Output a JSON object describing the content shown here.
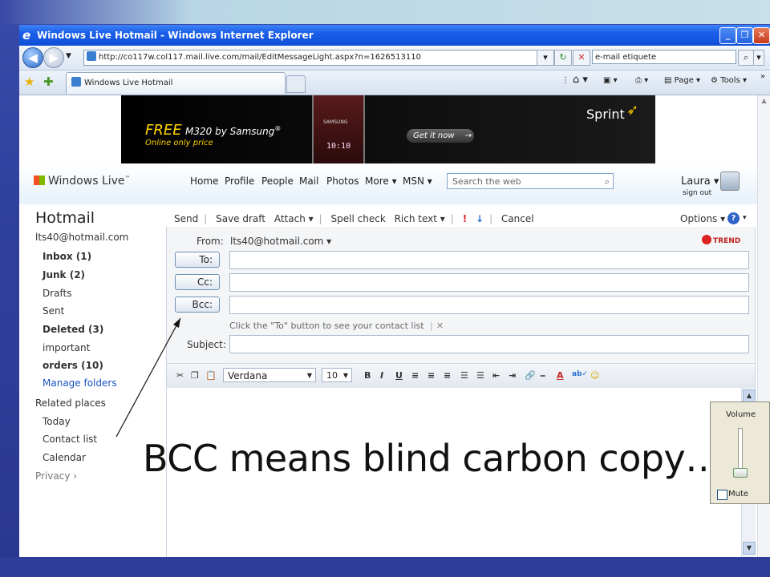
{
  "window": {
    "title": "Windows Live Hotmail - Windows Internet Explorer",
    "address": "http://co117w.col117.mail.live.com/mail/EditMessageLight.aspx?n=1626513110",
    "search_query": "e-mail etiquete",
    "tab_label": "Windows Live Hotmail",
    "cmd_page": "Page",
    "cmd_tools": "Tools"
  },
  "ad": {
    "free": "FREE",
    "model": "M320 by Samsung",
    "model_mark": "®",
    "online": "Online only price",
    "cta": "Get it now",
    "brand": "Sprint",
    "phone_brand": "SAMSUNG",
    "phone_time": "10:10"
  },
  "header": {
    "logo": "Windows Live",
    "logo_tm": "™",
    "nav": [
      "Home",
      "Profile",
      "People",
      "Mail",
      "Photos",
      "More ▾",
      "MSN ▾"
    ],
    "search_placeholder": "Search the web",
    "user_name": "Laura",
    "sign_out": "sign out"
  },
  "app": {
    "title": "Hotmail",
    "toolbar": [
      "Send",
      "Save draft",
      "Attach ▾",
      "Spell check",
      "Rich text ▾",
      "Cancel"
    ],
    "options": "Options ▾"
  },
  "sidebar": {
    "account": "lts40@hotmail.com",
    "folders": [
      {
        "label": "Inbox (1)",
        "bold": true
      },
      {
        "label": "Junk (2)",
        "bold": true
      },
      {
        "label": "Drafts",
        "bold": false
      },
      {
        "label": "Sent",
        "bold": false
      },
      {
        "label": "Deleted (3)",
        "bold": true
      },
      {
        "label": "important",
        "bold": false
      },
      {
        "label": "orders (10)",
        "bold": true
      }
    ],
    "manage_folders": "Manage folders",
    "related_heading": "Related places",
    "related": [
      "Today",
      "Contact list",
      "Calendar"
    ],
    "privacy": "Privacy ›"
  },
  "compose": {
    "from_label": "From:",
    "from_value": "lts40@hotmail.com ▾",
    "to_button": "To:",
    "cc_button": "Cc:",
    "bcc_button": "Bcc:",
    "hint": "Click the \"To\" button to see your contact list",
    "hint_close": "✕",
    "subject_label": "Subject:",
    "trend_logo": "TREND",
    "font": "Verdana",
    "size": "10"
  },
  "overlay": {
    "caption": "BCC means blind carbon copy…",
    "volume_label": "Volume",
    "mute_label": "Mute"
  }
}
